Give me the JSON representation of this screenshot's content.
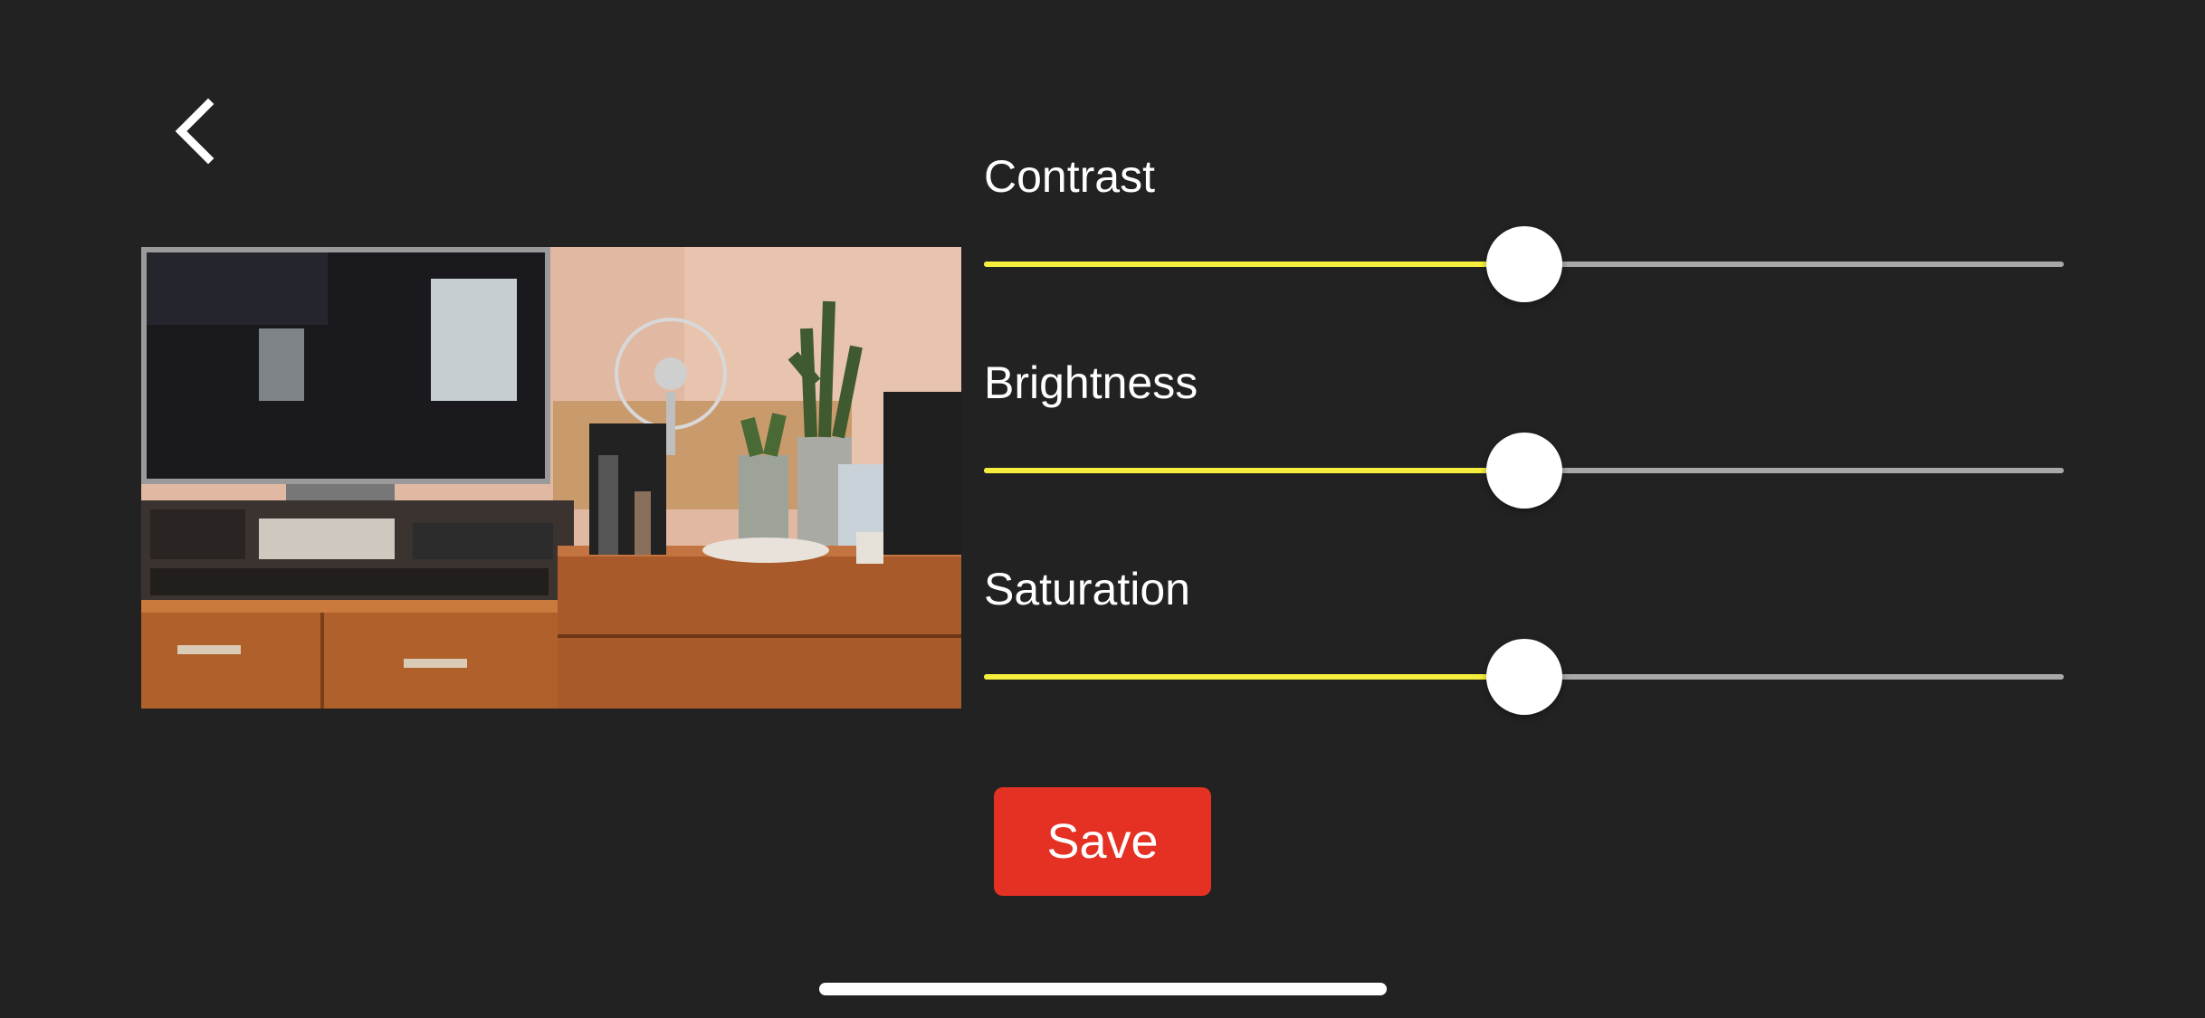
{
  "navigation": {
    "back_icon": "chevron-left-icon"
  },
  "preview": {
    "description_icon": "photo-preview"
  },
  "sliders": [
    {
      "label": "Contrast",
      "value": 0.5
    },
    {
      "label": "Brightness",
      "value": 0.5
    },
    {
      "label": "Saturation",
      "value": 0.5
    }
  ],
  "actions": {
    "save_label": "Save"
  },
  "colors": {
    "background": "#222222",
    "slider_fill": "#f5ee3c",
    "slider_track": "#a8a8a8",
    "save_button": "#e53124",
    "text": "#ffffff"
  }
}
